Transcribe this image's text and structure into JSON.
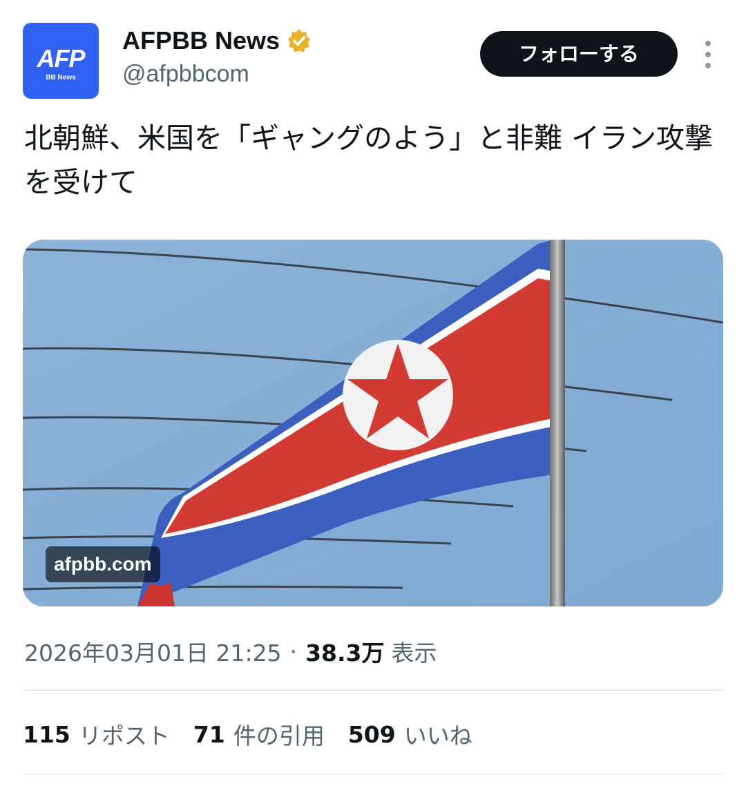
{
  "colors": {
    "text_primary": "#0f1419",
    "text_secondary": "#536471",
    "avatar_background": "#2f61f5",
    "verified_badge": "#e8b229",
    "follow_button_background": "#0f1419",
    "divider": "#cfd9de"
  },
  "author": {
    "avatar": {
      "logo_text": "AFP",
      "logo_subtext": "BB News"
    },
    "display_name": "AFPBB News",
    "verified_icon": "gold-verified-badge-icon",
    "handle": "@afpbbcom",
    "follow_label": "フォローする",
    "more_icon": "vertical-ellipsis-icon"
  },
  "tweet": {
    "text": "北朝鮮、米国を「ギャングのよう」と非難 イラン攻撃を受けて",
    "media": {
      "subject": "North Korean flag waving on a flagpole against a blue sky",
      "domain_label": "afpbb.com"
    },
    "meta": {
      "timestamp": "2026年03月01日 21:25",
      "separator": "·",
      "views_count": "38.3万",
      "views_label": "表示"
    },
    "stats": [
      {
        "count": "115",
        "label": "リポスト"
      },
      {
        "count": "71",
        "label": "件の引用"
      },
      {
        "count": "509",
        "label": "いいね"
      }
    ]
  }
}
